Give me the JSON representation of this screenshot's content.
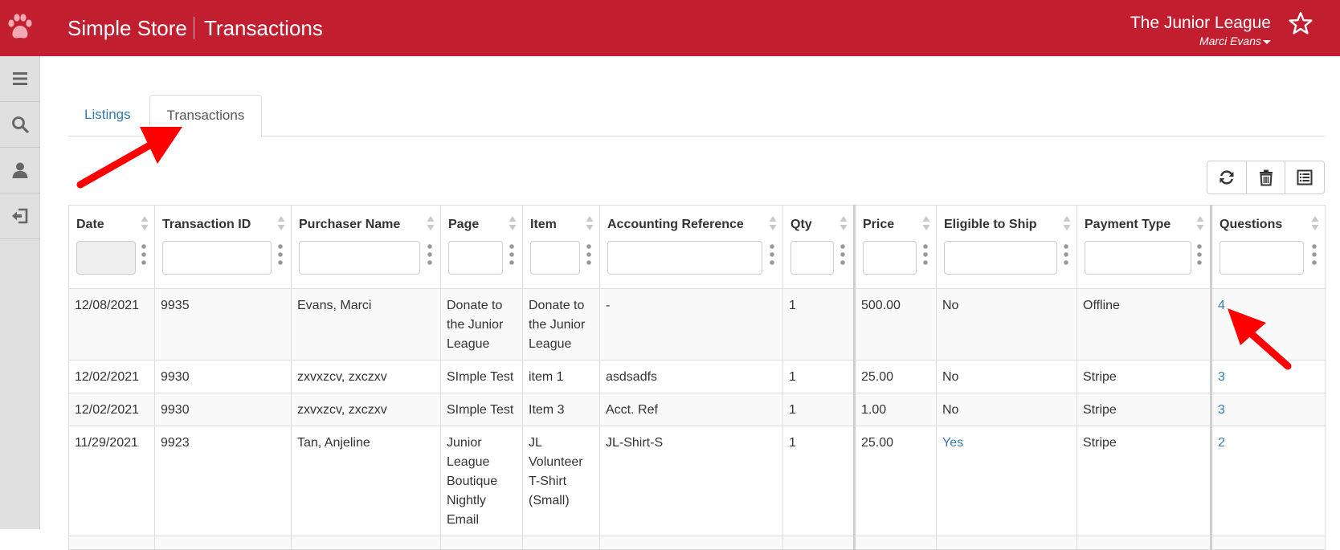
{
  "header": {
    "app_title": "Simple Store",
    "page_title": "Transactions",
    "org_name": "The Junior League",
    "user_name": "Marci Evans"
  },
  "colors": {
    "brand": "#c11e2f",
    "link": "#337ab7",
    "annotation_arrow": "#ff0000"
  },
  "sidebar": {
    "items": [
      {
        "icon": "menu-icon"
      },
      {
        "icon": "search-icon"
      },
      {
        "icon": "user-icon"
      },
      {
        "icon": "sign-out-icon"
      }
    ]
  },
  "tabs": [
    {
      "label": "Listings",
      "active": false
    },
    {
      "label": "Transactions",
      "active": true
    }
  ],
  "toolbar": {
    "buttons": [
      "refresh-icon",
      "trash-icon",
      "list-icon"
    ]
  },
  "table": {
    "columns": [
      "Date",
      "Transaction ID",
      "Purchaser Name",
      "Page",
      "Item",
      "Accounting Reference",
      "Qty",
      "Price",
      "Eligible to Ship",
      "Payment Type",
      "Questions"
    ],
    "rows": [
      {
        "date": "12/08/2021",
        "id": "9935",
        "purchaser": "Evans, Marci",
        "page": "Donate to the Junior League",
        "item": "Donate to the Junior League",
        "acct": "-",
        "qty": "1",
        "price": "500.00",
        "ship": "No",
        "payment": "Offline",
        "questions": "4"
      },
      {
        "date": "12/02/2021",
        "id": "9930",
        "purchaser": "zxvxzcv, zxczxv",
        "page": "SImple Test",
        "item": "item 1",
        "acct": "asdsadfs",
        "qty": "1",
        "price": "25.00",
        "ship": "No",
        "payment": "Stripe",
        "questions": "3"
      },
      {
        "date": "12/02/2021",
        "id": "9930",
        "purchaser": "zxvxzcv, zxczxv",
        "page": "SImple Test",
        "item": "Item 3",
        "acct": "Acct. Ref",
        "qty": "1",
        "price": "1.00",
        "ship": "No",
        "payment": "Stripe",
        "questions": "3"
      },
      {
        "date": "11/29/2021",
        "id": "9923",
        "purchaser": "Tan, Anjeline",
        "page": "Junior League Boutique Nightly Email",
        "item": "JL Volunteer T-Shirt (Small)",
        "acct": "JL-Shirt-S",
        "qty": "1",
        "price": "25.00",
        "ship": "Yes",
        "payment": "Stripe",
        "questions": "2"
      }
    ]
  }
}
